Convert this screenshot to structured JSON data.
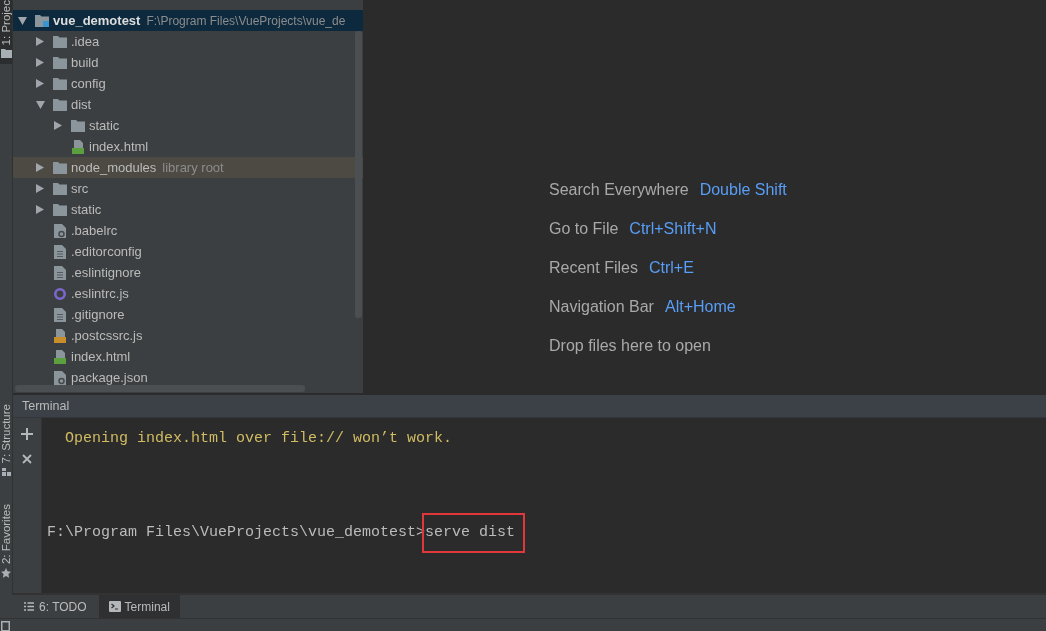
{
  "tool_strip": {
    "tabs": [
      {
        "label": "1: Projec",
        "selected": true
      },
      {
        "label": "7: Structure",
        "selected": false
      },
      {
        "label": "2: Favorites",
        "selected": false
      }
    ]
  },
  "project_tree": {
    "items": [
      {
        "kind": "module",
        "label": "vue_demotest",
        "path": "F:\\Program Files\\VueProjects\\vue_de",
        "expanded": true,
        "selected": true,
        "highlighted": false,
        "children": [
          {
            "kind": "folder",
            "label": ".idea",
            "expanded": false,
            "selected": false,
            "highlighted": false
          },
          {
            "kind": "folder",
            "label": "build",
            "expanded": false,
            "selected": false,
            "highlighted": false
          },
          {
            "kind": "folder",
            "label": "config",
            "expanded": false,
            "selected": false,
            "highlighted": false
          },
          {
            "kind": "folder",
            "label": "dist",
            "expanded": true,
            "selected": false,
            "highlighted": false,
            "children": [
              {
                "kind": "folder",
                "label": "static",
                "expanded": false,
                "selected": false,
                "highlighted": false
              },
              {
                "kind": "html",
                "label": "index.html",
                "selected": false,
                "highlighted": false
              }
            ]
          },
          {
            "kind": "folder",
            "label": "node_modules",
            "note": "library root",
            "expanded": false,
            "selected": false,
            "highlighted": true
          },
          {
            "kind": "folder",
            "label": "src",
            "expanded": false,
            "selected": false,
            "highlighted": false
          },
          {
            "kind": "folder",
            "label": "static",
            "expanded": false,
            "selected": false,
            "highlighted": false
          },
          {
            "kind": "config",
            "label": ".babelrc",
            "selected": false,
            "highlighted": false
          },
          {
            "kind": "text",
            "label": ".editorconfig",
            "selected": false,
            "highlighted": false
          },
          {
            "kind": "text",
            "label": ".eslintignore",
            "selected": false,
            "highlighted": false
          },
          {
            "kind": "eslint",
            "label": ".eslintrc.js",
            "selected": false,
            "highlighted": false
          },
          {
            "kind": "text",
            "label": ".gitignore",
            "selected": false,
            "highlighted": false
          },
          {
            "kind": "js",
            "label": ".postcssrc.js",
            "selected": false,
            "highlighted": false
          },
          {
            "kind": "html",
            "label": "index.html",
            "selected": false,
            "highlighted": false
          },
          {
            "kind": "config",
            "label": "package.json",
            "selected": false,
            "highlighted": false
          }
        ]
      }
    ]
  },
  "editor_hints": [
    {
      "label": "Search Everywhere",
      "shortcut": "Double Shift"
    },
    {
      "label": "Go to File",
      "shortcut": "Ctrl+Shift+N"
    },
    {
      "label": "Recent Files",
      "shortcut": "Ctrl+E"
    },
    {
      "label": "Navigation Bar",
      "shortcut": "Alt+Home"
    },
    {
      "label": "Drop files here to open"
    }
  ],
  "terminal": {
    "title": "Terminal",
    "lines": [
      {
        "kind": "output",
        "text": "Opening index.html over file:// won’t work."
      },
      {
        "kind": "prompt",
        "prompt": "F:\\Program Files\\VueProjects\\vue_demotest>",
        "command": "serve dist",
        "boxed": true
      }
    ]
  },
  "bottom_tabs": [
    {
      "label": "6: TODO",
      "selected": false
    },
    {
      "label": "Terminal",
      "selected": true
    }
  ]
}
